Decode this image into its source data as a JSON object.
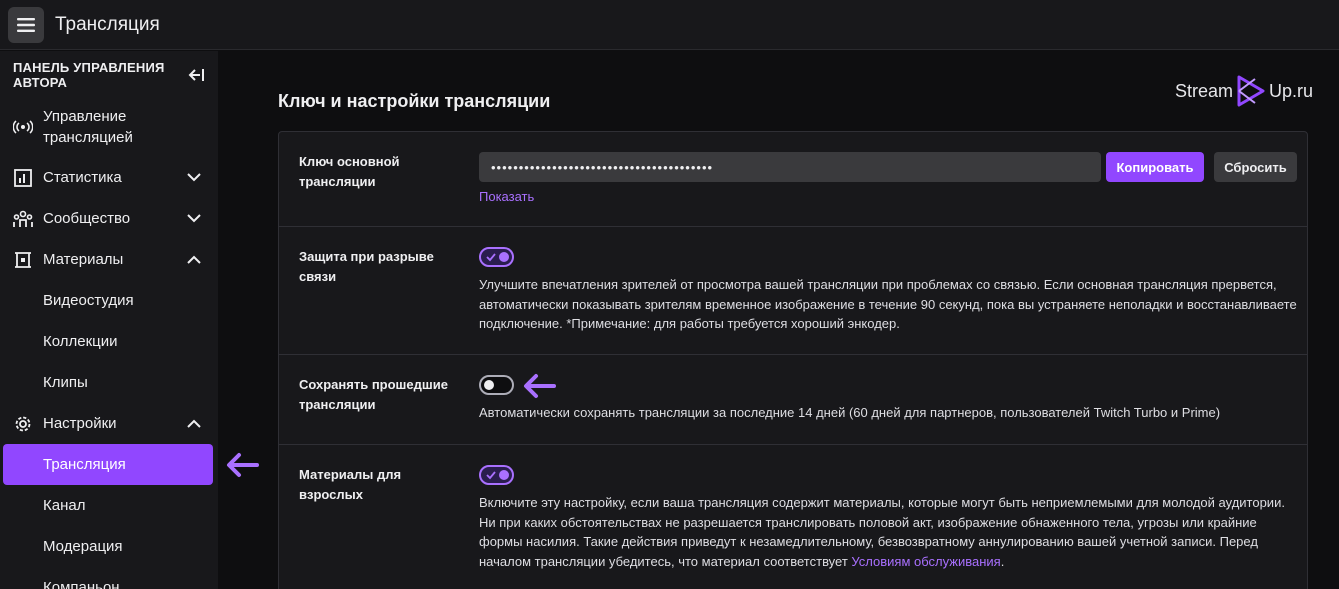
{
  "topbar": {
    "title": "Трансляция"
  },
  "sidebar": {
    "heading": "ПАНЕЛЬ УПРАВЛЕНИЯ АВТОРА",
    "items": [
      {
        "label": "Управление трансляцией",
        "icon": "broadcast-icon"
      },
      {
        "label": "Статистика",
        "icon": "stats-icon",
        "expanded": false
      },
      {
        "label": "Сообщество",
        "icon": "community-icon",
        "expanded": false
      },
      {
        "label": "Материалы",
        "icon": "content-icon",
        "expanded": true
      },
      {
        "label": "Видеостудия"
      },
      {
        "label": "Коллекции"
      },
      {
        "label": "Клипы"
      },
      {
        "label": "Настройки",
        "icon": "gear-icon",
        "expanded": true
      },
      {
        "label": "Трансляция",
        "active": true
      },
      {
        "label": "Канал"
      },
      {
        "label": "Модерация"
      },
      {
        "label": "Компаньон"
      }
    ]
  },
  "logo": {
    "left": "Stream",
    "right": "Up.ru"
  },
  "main": {
    "section_title": "Ключ и настройки трансляции",
    "stream_key": {
      "label": "Ключ основной трансляции",
      "value": "••••••••••••••••••••••••••••••••••••••••",
      "copy_label": "Копировать",
      "reset_label": "Сбросить",
      "show_label": "Показать"
    },
    "disconnect_protection": {
      "label": "Защита при разрыве связи",
      "enabled": true,
      "description": "Улучшите впечатления зрителей от просмотра вашей трансляции при проблемах со связью. Если основная трансляция прервется, автоматически показывать зрителям временное изображение в течение 90 секунд, пока вы устраняете неполадки и восстанавливаете подключение. *Примечание: для работы требуется хороший энкодер."
    },
    "store_past": {
      "label": "Сохранять прошедшие трансляции",
      "enabled": false,
      "description": "Автоматически сохранять трансляции за последние 14 дней (60 дней для партнеров, пользователей Twitch Turbo и Prime)"
    },
    "mature": {
      "label": "Материалы для взрослых",
      "enabled": true,
      "description": "Включите эту настройку, если ваша трансляция содержит материалы, которые могут быть неприемлемыми для молодой аудитории. Ни при каких обстоятельствах не разрешается транслировать половой акт, изображение обнаженного тела, угрозы или крайние формы насилия. Такие действия приведут к незамедлительному, безвозвратному аннулированию вашей учетной записи. Перед началом трансляции убедитесь, что материал соответствует ",
      "tos_link": "Условиям обслуживания",
      "tail": "."
    }
  },
  "colors": {
    "accent": "#9147ff",
    "link": "#a970ff",
    "annotation_arrow": "#a970ff"
  }
}
